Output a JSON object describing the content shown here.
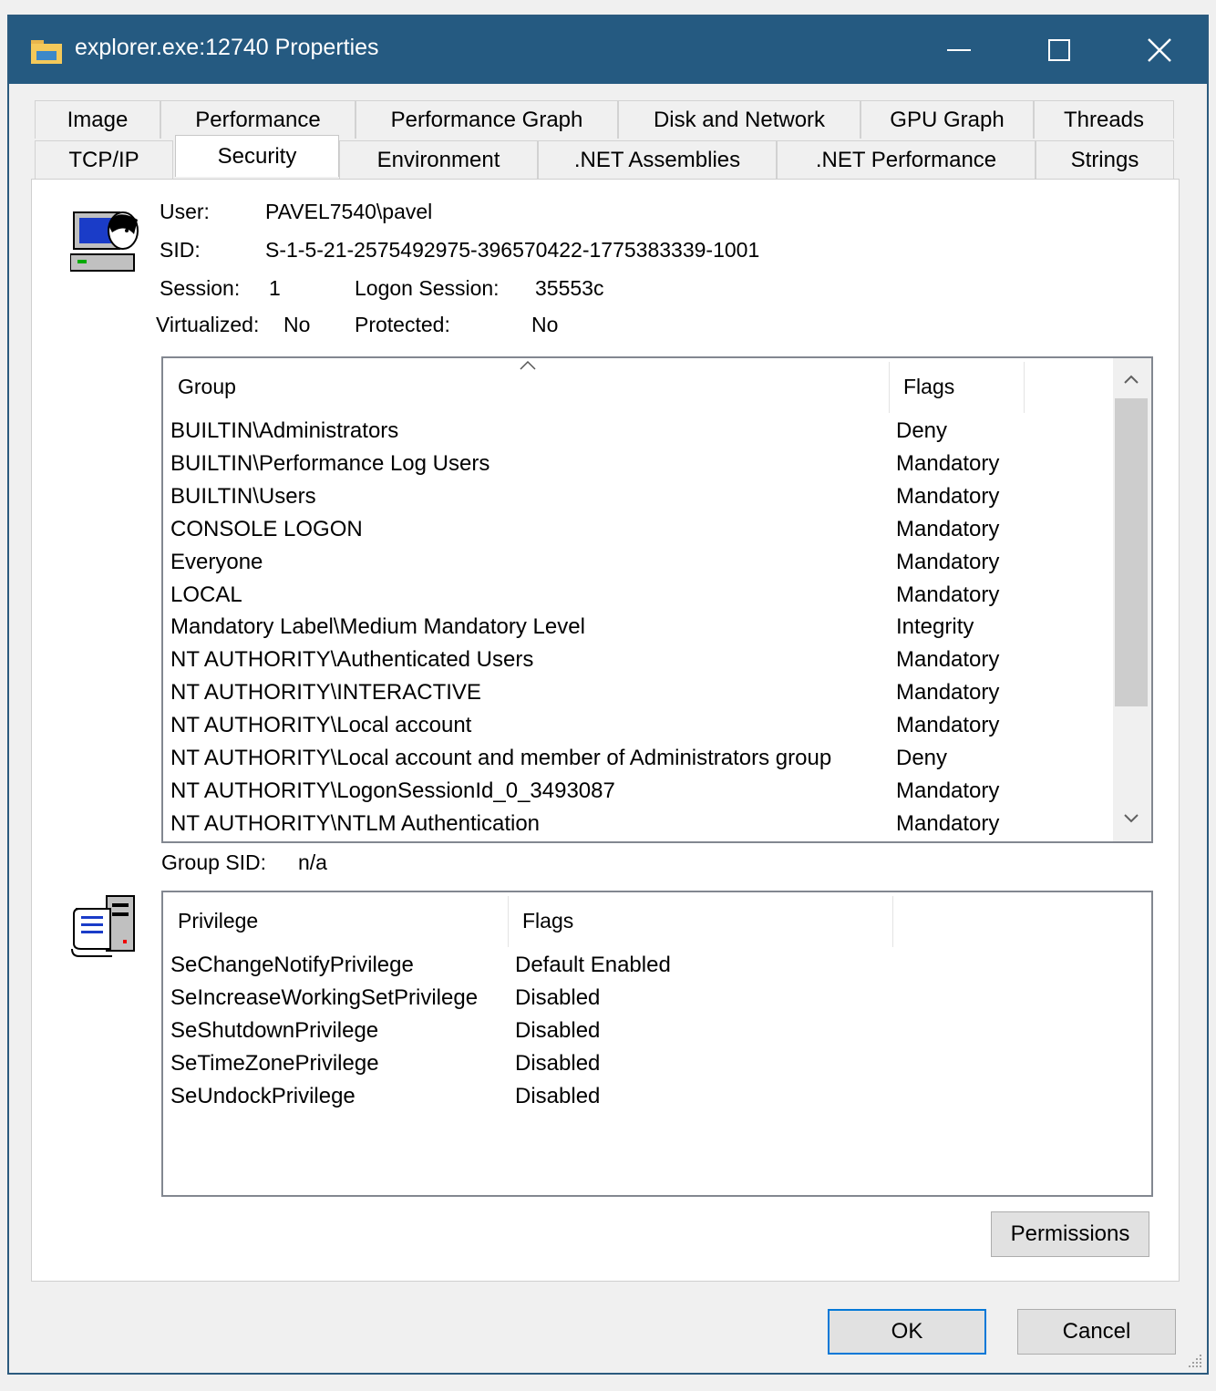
{
  "window": {
    "title": "explorer.exe:12740 Properties"
  },
  "tabs_row1": [
    "Image",
    "Performance",
    "Performance Graph",
    "Disk and Network",
    "GPU Graph",
    "Threads"
  ],
  "tabs_row2": [
    "TCP/IP",
    "Security",
    "Environment",
    ".NET Assemblies",
    ".NET Performance",
    "Strings"
  ],
  "security": {
    "user_label": "User:",
    "user_value": "PAVEL7540\\pavel",
    "sid_label": "SID:",
    "sid_value": "S-1-5-21-2575492975-396570422-1775383339-1001",
    "session_label": "Session:",
    "session_value": "1",
    "logon_session_label": "Logon Session:",
    "logon_session_value": "35553c",
    "virtualized_label": "Virtualized:",
    "virtualized_value": "No",
    "protected_label": "Protected:",
    "protected_value": "No",
    "group_sid_label": "Group SID:",
    "group_sid_value": "n/a"
  },
  "groups": {
    "columns": [
      "Group",
      "Flags"
    ],
    "rows": [
      {
        "group": "BUILTIN\\Administrators",
        "flags": "Deny"
      },
      {
        "group": "BUILTIN\\Performance Log Users",
        "flags": "Mandatory"
      },
      {
        "group": "BUILTIN\\Users",
        "flags": "Mandatory"
      },
      {
        "group": "CONSOLE LOGON",
        "flags": "Mandatory"
      },
      {
        "group": "Everyone",
        "flags": "Mandatory"
      },
      {
        "group": "LOCAL",
        "flags": "Mandatory"
      },
      {
        "group": "Mandatory Label\\Medium Mandatory Level",
        "flags": "Integrity"
      },
      {
        "group": "NT AUTHORITY\\Authenticated Users",
        "flags": "Mandatory"
      },
      {
        "group": "NT AUTHORITY\\INTERACTIVE",
        "flags": "Mandatory"
      },
      {
        "group": "NT AUTHORITY\\Local account",
        "flags": "Mandatory"
      },
      {
        "group": "NT AUTHORITY\\Local account and member of Administrators group",
        "flags": "Deny"
      },
      {
        "group": "NT AUTHORITY\\LogonSessionId_0_3493087",
        "flags": "Mandatory"
      },
      {
        "group": "NT AUTHORITY\\NTLM Authentication",
        "flags": "Mandatory"
      }
    ]
  },
  "privileges": {
    "columns": [
      "Privilege",
      "Flags"
    ],
    "rows": [
      {
        "privilege": "SeChangeNotifyPrivilege",
        "flags": "Default Enabled"
      },
      {
        "privilege": "SeIncreaseWorkingSetPrivilege",
        "flags": "Disabled"
      },
      {
        "privilege": "SeShutdownPrivilege",
        "flags": "Disabled"
      },
      {
        "privilege": "SeTimeZonePrivilege",
        "flags": "Disabled"
      },
      {
        "privilege": "SeUndockPrivilege",
        "flags": "Disabled"
      }
    ]
  },
  "buttons": {
    "permissions": "Permissions",
    "ok": "OK",
    "cancel": "Cancel"
  },
  "icons": {
    "title": "folder-icon",
    "user": "user-computer-icon",
    "privilege": "privilege-scroll-icon",
    "sort": "sort-up-icon"
  },
  "colors": {
    "titlebar": "#255a81",
    "focus_border": "#0078d7"
  }
}
